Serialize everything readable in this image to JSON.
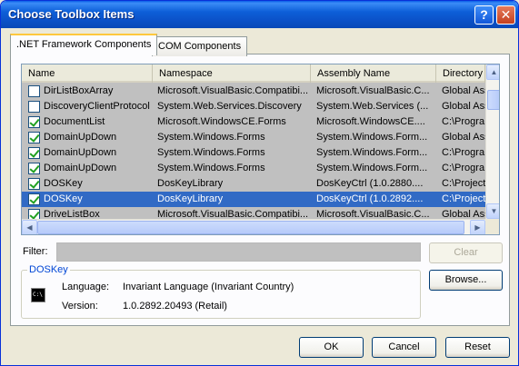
{
  "window": {
    "title": "Choose Toolbox Items"
  },
  "tabs": [
    {
      "label": ".NET Framework Components"
    },
    {
      "label": "COM Components"
    }
  ],
  "list": {
    "columns": [
      "Name",
      "Namespace",
      "Assembly Name",
      "Directory"
    ],
    "rows": [
      {
        "checked": false,
        "name": "DirListBoxArray",
        "namespace": "Microsoft.VisualBasic.Compatibi...",
        "assembly": "Microsoft.VisualBasic.C...",
        "directory": "Global Ass"
      },
      {
        "checked": false,
        "name": "DiscoveryClientProtocol",
        "namespace": "System.Web.Services.Discovery",
        "assembly": "System.Web.Services (...",
        "directory": "Global Ass"
      },
      {
        "checked": true,
        "name": "DocumentList",
        "namespace": "Microsoft.WindowsCE.Forms",
        "assembly": "Microsoft.WindowsCE....",
        "directory": "C:\\Progra"
      },
      {
        "checked": true,
        "name": "DomainUpDown",
        "namespace": "System.Windows.Forms",
        "assembly": "System.Windows.Form...",
        "directory": "Global Ass"
      },
      {
        "checked": true,
        "name": "DomainUpDown",
        "namespace": "System.Windows.Forms",
        "assembly": "System.Windows.Form...",
        "directory": "C:\\Progra"
      },
      {
        "checked": true,
        "name": "DomainUpDown",
        "namespace": "System.Windows.Forms",
        "assembly": "System.Windows.Form...",
        "directory": "C:\\Progra"
      },
      {
        "checked": true,
        "name": "DOSKey",
        "namespace": "DosKeyLibrary",
        "assembly": "DosKeyCtrl (1.0.2880....",
        "directory": "C:\\Project"
      },
      {
        "checked": true,
        "name": "DOSKey",
        "namespace": "DosKeyLibrary",
        "assembly": "DosKeyCtrl (1.0.2892....",
        "directory": "C:\\Project",
        "selected": true
      },
      {
        "checked": true,
        "name": "DriveListBox",
        "namespace": "Microsoft.VisualBasic.Compatibi...",
        "assembly": "Microsoft.VisualBasic.C...",
        "directory": "Global Ass"
      }
    ]
  },
  "filter": {
    "label": "Filter:",
    "value": ""
  },
  "buttons": {
    "clear": "Clear",
    "browse": "Browse...",
    "ok": "OK",
    "cancel": "Cancel",
    "reset": "Reset"
  },
  "details": {
    "title": "DOSKey",
    "icon": "console-icon",
    "icon_text": "C:\\",
    "language_label": "Language:",
    "language_value": "Invariant Language (Invariant Country)",
    "version_label": "Version:",
    "version_value": "1.0.2892.20493 (Retail)"
  },
  "colors": {
    "titlebar": "#0b52c9",
    "selection": "#316ac5",
    "group_title": "#0046d5",
    "check": "#21a121"
  }
}
